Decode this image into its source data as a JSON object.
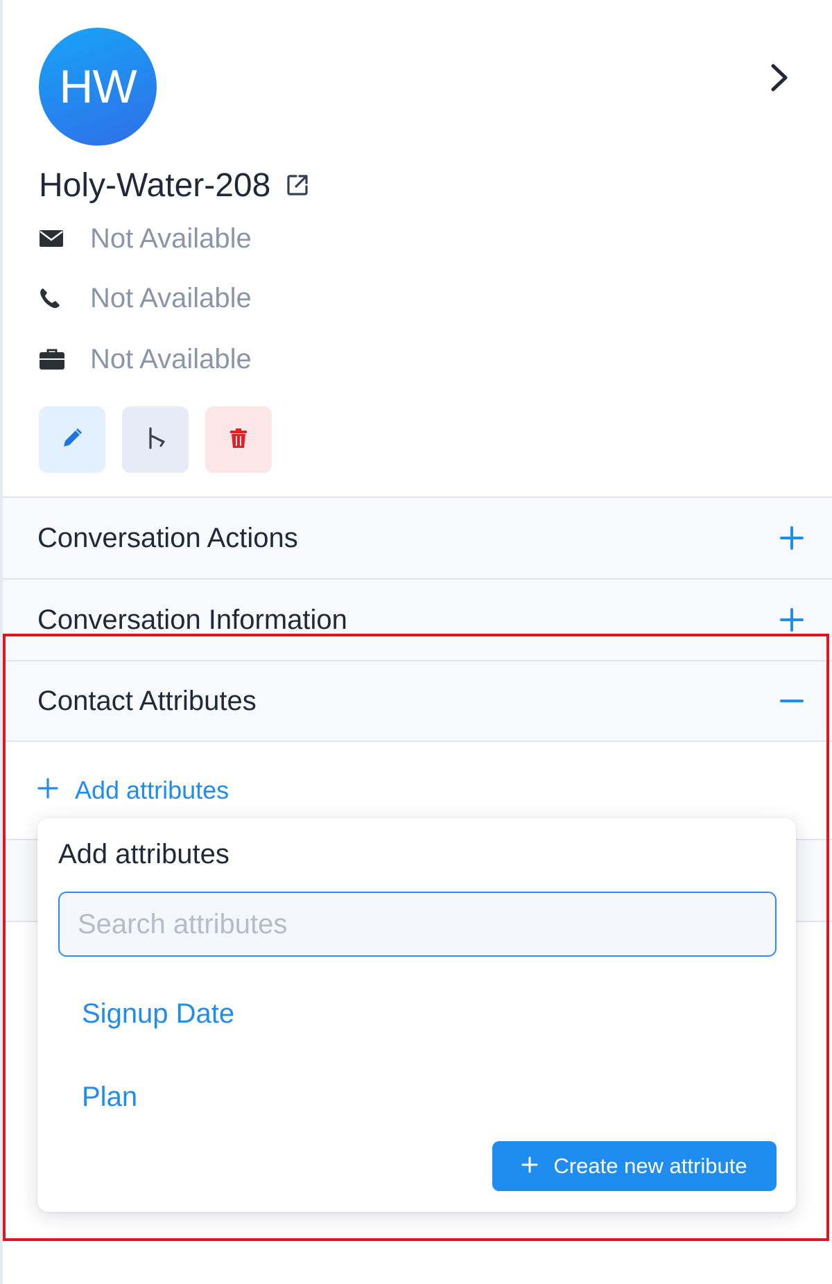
{
  "contact": {
    "initials": "HW",
    "name": "Holy-Water-208",
    "email": "Not Available",
    "phone": "Not Available",
    "company": "Not Available"
  },
  "sections": {
    "conversation_actions": "Conversation Actions",
    "conversation_information": "Conversation Information",
    "contact_attributes": "Contact Attributes"
  },
  "attributes": {
    "add_link": "Add attributes",
    "popover_title": "Add attributes",
    "search_placeholder": "Search attributes",
    "options": [
      "Signup Date",
      "Plan"
    ],
    "create_button": "Create new attribute"
  },
  "colors": {
    "accent": "#1f8cf0",
    "highlight": "#e3141d",
    "delete": "#e0222b"
  },
  "icons": {
    "expand": "chevron-right-icon",
    "external": "external-link-icon",
    "email": "envelope-icon",
    "phone": "phone-icon",
    "company": "briefcase-icon",
    "edit": "pencil-icon",
    "merge": "merge-icon",
    "delete": "trash-icon",
    "add": "plus-icon",
    "collapse": "minus-icon"
  }
}
